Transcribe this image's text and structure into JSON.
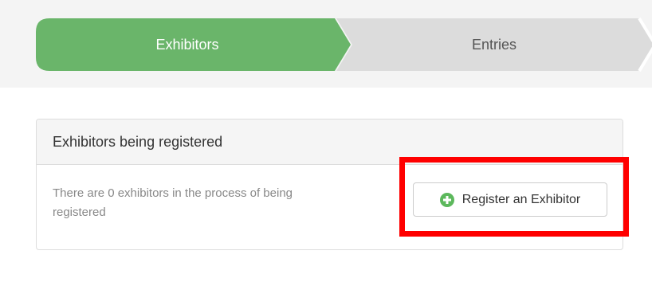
{
  "stepper": {
    "steps": [
      {
        "label": "Exhibitors",
        "state": "active",
        "color": "#6ab56a"
      },
      {
        "label": "Entries",
        "state": "inactive",
        "color": "#dcdcdc"
      }
    ]
  },
  "panel": {
    "title": "Exhibitors being registered",
    "status_text": "There are 0 exhibitors in the process of being registered",
    "register_button_label": "Register an Exhibitor",
    "register_button_icon": "plus-circle-icon",
    "icon_color": "#5cb85c"
  },
  "annotation": {
    "highlight_color": "#ff0000"
  }
}
